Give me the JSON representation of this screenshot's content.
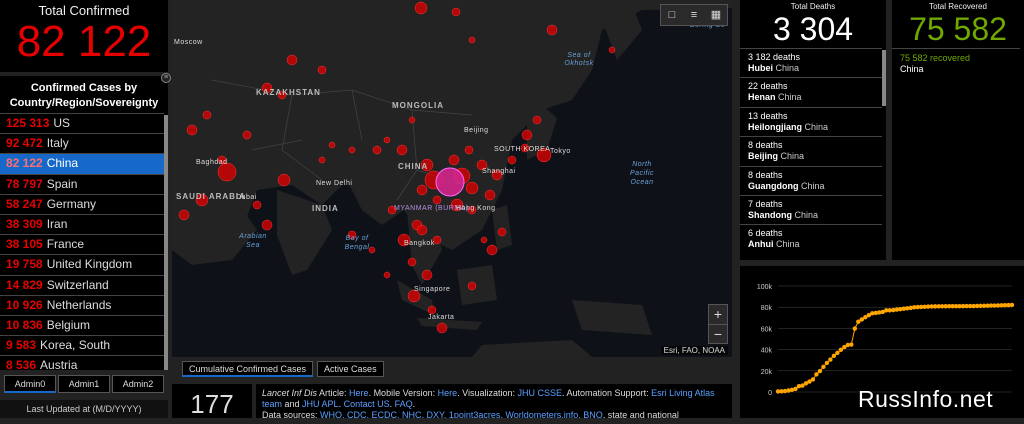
{
  "total_confirmed": {
    "label": "Total Confirmed",
    "value": "82 122"
  },
  "country_list": {
    "header": "Confirmed Cases by Country/Region/Sovereignty",
    "rows": [
      {
        "count": "125 313",
        "country": "US"
      },
      {
        "count": "92 472",
        "country": "Italy"
      },
      {
        "count": "82 122",
        "country": "China"
      },
      {
        "count": "78 797",
        "country": "Spain"
      },
      {
        "count": "58 247",
        "country": "Germany"
      },
      {
        "count": "38 309",
        "country": "Iran"
      },
      {
        "count": "38 105",
        "country": "France"
      },
      {
        "count": "19 758",
        "country": "United Kingdom"
      },
      {
        "count": "14 829",
        "country": "Switzerland"
      },
      {
        "count": "10 926",
        "country": "Netherlands"
      },
      {
        "count": "10 836",
        "country": "Belgium"
      },
      {
        "count": "9 583",
        "country": "Korea, South"
      },
      {
        "count": "8 536",
        "country": "Austria"
      }
    ]
  },
  "admin_tabs": [
    "Admin0",
    "Admin1",
    "Admin2"
  ],
  "last_updated": "Last Updated at (M/D/YYYY)",
  "map": {
    "labels": {
      "moscow": "Moscow",
      "kazakhstan": "KAZAKHSTAN",
      "mongolia": "MONGOLIA",
      "beijing": "Beijing",
      "south_korea": "SOUTH KOREA",
      "tokyo": "Tokyo",
      "china": "CHINA",
      "shanghai": "Shanghai",
      "baghdad": "Baghdad",
      "new_delhi": "New Delhi",
      "india": "INDIA",
      "saudi": "SAUDI ARABIA",
      "dubai": "Dubai",
      "myanmar": "MYANMAR (BURMA)",
      "hong_kong": "Hong Kong",
      "bangkok": "Bangkok",
      "singapore": "Singapore",
      "jakarta": "Jakarta",
      "sea_okhotsk": "Sea of Okhotsk",
      "bering": "Bering Se",
      "north_pacific": "North Pacific Ocean",
      "arabian_sea": "Arabian Sea",
      "bay_bengal": "Bay of Bengal"
    },
    "attribution": "Esri, FAO, NOAA",
    "tools": [
      "bookmark-icon",
      "legend-icon",
      "basemap-icon"
    ],
    "zoom_in": "+",
    "zoom_out": "−",
    "tabs": [
      "Cumulative Confirmed Cases",
      "Active Cases"
    ]
  },
  "bottom": {
    "count": "177",
    "credits": {
      "lancet": "Lancet Inf Dis",
      "article": " Article: ",
      "here": "Here",
      "mobile": ". Mobile Version: ",
      "here2": "Here",
      "visualization": ". Visualization: ",
      "jhu": "JHU CSSE",
      "automation": ". Automation Support: ",
      "esri": "Esri Living Atlas team",
      "and": " and ",
      "jhuapl": "JHU APL",
      "sep": ". ",
      "contact": "Contact US",
      "sep2": ". ",
      "faq": "FAQ",
      "sep3": ".",
      "sources_label": "Data sources: ",
      "sources": "WHO, CDC, ECDC, NHC, DXY, 1point3acres, Worldometers.info, BNO",
      "sources_tail": ", state and national"
    }
  },
  "total_deaths": {
    "label": "Total Deaths",
    "value": "3 304"
  },
  "deaths_list": [
    {
      "deaths": "3 182 deaths",
      "province": "Hubei",
      "country": "China"
    },
    {
      "deaths": "22 deaths",
      "province": "Henan",
      "country": "China"
    },
    {
      "deaths": "13 deaths",
      "province": "Heilongjiang",
      "country": "China"
    },
    {
      "deaths": "8 deaths",
      "province": "Beijing",
      "country": "China"
    },
    {
      "deaths": "8 deaths",
      "province": "Guangdong",
      "country": "China"
    },
    {
      "deaths": "7 deaths",
      "province": "Shandong",
      "country": "China"
    },
    {
      "deaths": "6 deaths",
      "province": "Anhui",
      "country": "China"
    }
  ],
  "total_recovered": {
    "label": "Total Recovered",
    "value": "75 582"
  },
  "recovered_list": [
    {
      "recovered": "75 582 recovered",
      "country": "China"
    }
  ],
  "watermark": "RussInfo.net",
  "colors": {
    "confirmed": "#e60000",
    "recovered": "#70a800",
    "selected": "#1769c9",
    "chart_line": "#ffa500"
  },
  "chart_data": {
    "type": "line",
    "ylim": [
      0,
      100000
    ],
    "yticks": [
      "0",
      "20k",
      "40k",
      "60k",
      "80k",
      "100k"
    ],
    "ytick_values": [
      0,
      20000,
      40000,
      60000,
      80000,
      100000
    ],
    "x": [
      1,
      2,
      3,
      4,
      5,
      6,
      7,
      8,
      9,
      10,
      11,
      12,
      13,
      14,
      15,
      16,
      17,
      18,
      19,
      20,
      21,
      22,
      23,
      24,
      25,
      26,
      27,
      28,
      29,
      30,
      31,
      32,
      33,
      34,
      35,
      36,
      37,
      38,
      39,
      40,
      41,
      42,
      43,
      44,
      45,
      46,
      47,
      48,
      49,
      50,
      51,
      52,
      53,
      54,
      55,
      56,
      57,
      58,
      59,
      60,
      61,
      62,
      63,
      64,
      65,
      66,
      67,
      68
    ],
    "series": [
      {
        "values": [
          548,
          643,
          920,
          1406,
          2075,
          2877,
          5509,
          6087,
          8141,
          9802,
          11891,
          16630,
          19716,
          23707,
          27440,
          30587,
          34110,
          36814,
          39829,
          42354,
          44386,
          44759,
          59895,
          66358,
          68413,
          70513,
          72434,
          74211,
          74619,
          75077,
          75550,
          77001,
          77022,
          77241,
          77754,
          78166,
          78600,
          78928,
          79356,
          79932,
          80136,
          80261,
          80386,
          80537,
          80690,
          80770,
          80823,
          80860,
          80887,
          80921,
          80932,
          80945,
          80977,
          81003,
          81033,
          81058,
          81102,
          81156,
          81250,
          81305,
          81435,
          81498,
          81591,
          81661,
          81782,
          81897,
          81999,
          82122
        ]
      }
    ]
  }
}
